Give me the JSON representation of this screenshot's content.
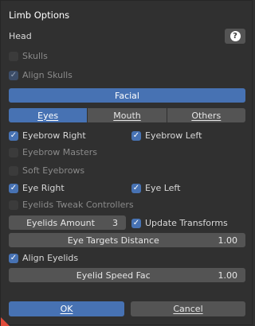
{
  "dialog": {
    "title": "Limb Options",
    "head_label": "Head",
    "help_icon": "?",
    "skulls": {
      "label": "Skulls",
      "checked": false,
      "enabled": false
    },
    "align_skulls": {
      "label": "Align Skulls",
      "checked": true,
      "enabled": false
    },
    "facial_label": "Facial",
    "tabs": [
      {
        "label": "Eyes",
        "active": true
      },
      {
        "label": "Mouth",
        "active": false
      },
      {
        "label": "Others",
        "active": false
      }
    ],
    "eyebrow_right": {
      "label": "Eyebrow Right",
      "checked": true
    },
    "eyebrow_left": {
      "label": "Eyebrow Left",
      "checked": true
    },
    "eyebrow_masters": {
      "label": "Eyebrow Masters",
      "checked": false,
      "enabled": false
    },
    "soft_eyebrows": {
      "label": "Soft Eyebrows",
      "checked": false,
      "enabled": false
    },
    "eye_right": {
      "label": "Eye Right",
      "checked": true
    },
    "eye_left": {
      "label": "Eye Left",
      "checked": true
    },
    "eyelids_tweak": {
      "label": "Eyelids Tweak Controllers",
      "checked": false,
      "enabled": false
    },
    "eyelids_amount": {
      "label": "Eyelids Amount",
      "value": "3"
    },
    "update_transforms": {
      "label": "Update Transforms",
      "checked": true
    },
    "eye_targets_distance": {
      "label": "Eye Targets Distance",
      "value": "1.00"
    },
    "align_eyelids": {
      "label": "Align Eyelids",
      "checked": true
    },
    "eyelid_speed_fac": {
      "label": "Eyelid Speed Fac",
      "value": "1.00"
    },
    "ok_label": "OK",
    "cancel_label": "Cancel",
    "check_glyph": "✓",
    "accent_color": "#4772b3"
  }
}
